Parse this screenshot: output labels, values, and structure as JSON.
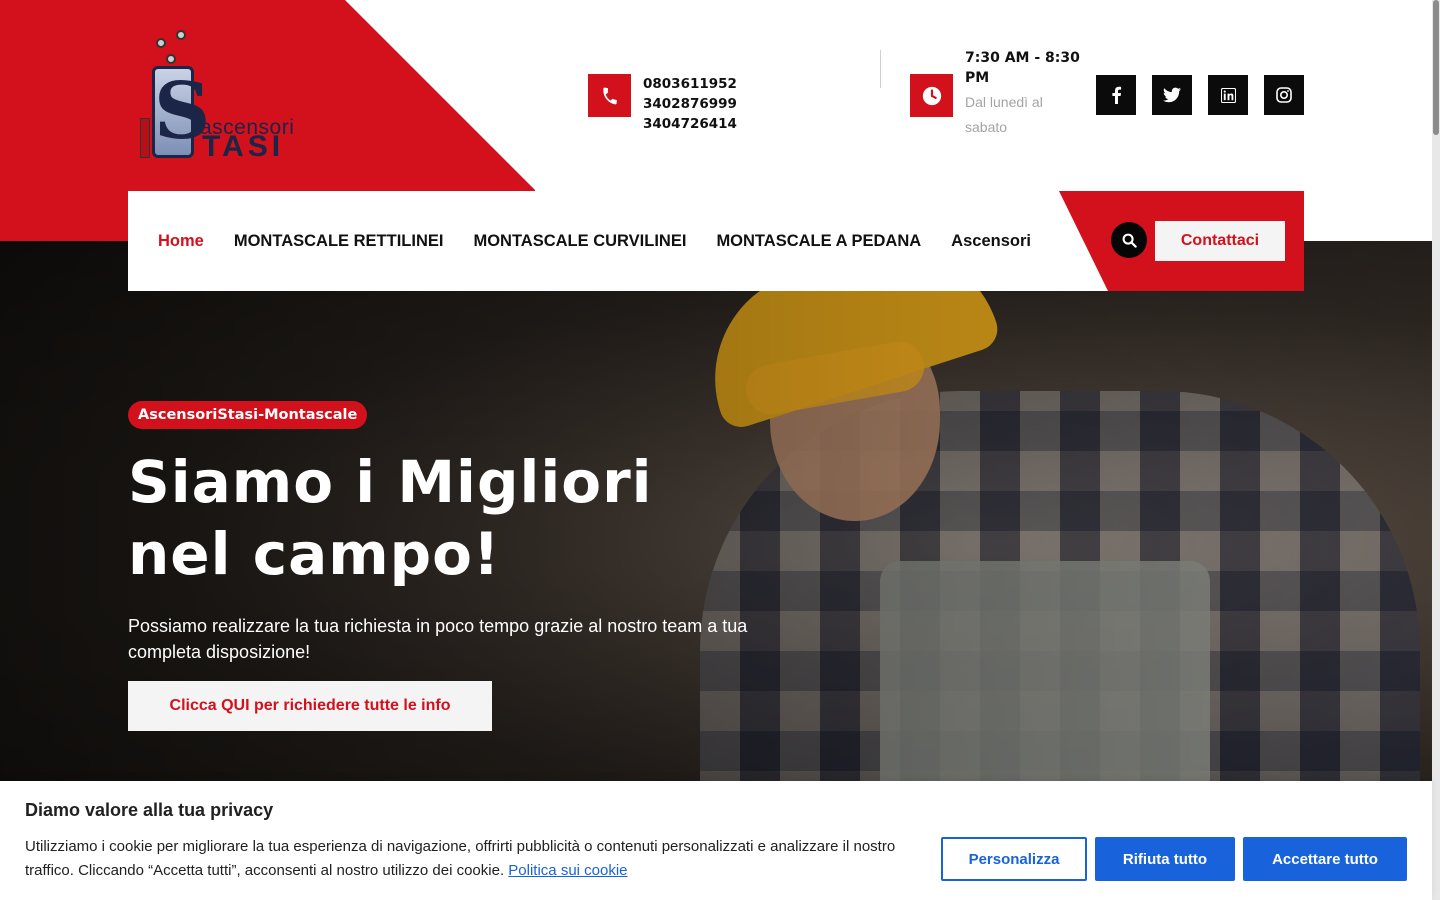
{
  "brand": {
    "logo_word1": "ascensori",
    "logo_word2": "TASI",
    "accent_color": "#d2111c"
  },
  "header": {
    "phone": "0803611952 3402876999 3404726414",
    "hours_title": "7:30 AM - 8:30 PM",
    "hours_sub": "Dal lunedì al sabato",
    "social": [
      "facebook-icon",
      "twitter-icon",
      "linkedin-icon",
      "instagram-icon"
    ]
  },
  "nav": {
    "items": [
      {
        "label": "Home",
        "active": true
      },
      {
        "label": "MONTASCALE RETTILINEI"
      },
      {
        "label": "MONTASCALE CURVILINEI"
      },
      {
        "label": "MONTASCALE A PEDANA"
      },
      {
        "label": "Ascensori"
      }
    ],
    "contact_label": "Contattaci"
  },
  "hero": {
    "tag": "AscensoriStasi-Montascale",
    "title": "Siamo i Migliori nel campo!",
    "description": "Possiamo realizzare la tua richiesta in poco tempo grazie al nostro team a tua completa disposizione!",
    "cta": "Clicca QUI per richiedere tutte le info"
  },
  "cookie": {
    "title": "Diamo valore alla tua privacy",
    "text": "Utilizziamo i cookie per migliorare la tua esperienza di navigazione, offrirti pubblicità o contenuti personalizzati e analizzare il nostro traffico. Cliccando “Accetta tutti”, acconsenti al nostro utilizzo dei cookie.",
    "policy_link": "Politica sui cookie",
    "customize": "Personalizza",
    "reject": "Rifiuta tutto",
    "accept": "Accettare tutto",
    "button_color": "#1863dc"
  }
}
